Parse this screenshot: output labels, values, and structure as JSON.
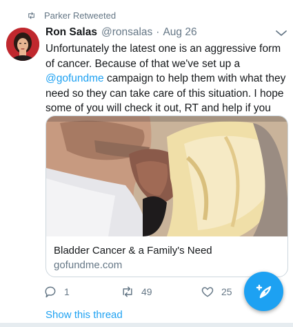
{
  "retweet": {
    "label": "Parker Retweeted"
  },
  "author": {
    "name": "Ron Salas",
    "handle": "@ronsalas",
    "separator": "·",
    "date": "Aug 26"
  },
  "tweet": {
    "text_before": "Unfortunately the latest one is an aggressive form of cancer. Because of that we've set up a ",
    "mention": "@gofundme",
    "text_after": " campaign to help them with what they need so they can take care of this situation. I hope some of you will check it out, RT and help if you can."
  },
  "card": {
    "title": "Bladder Cancer & a Family's Need",
    "domain": "gofundme.com"
  },
  "actions": {
    "replies": "1",
    "retweets": "49",
    "likes": "25"
  },
  "thread_link": "Show this thread",
  "colors": {
    "accent": "#1da1f2",
    "secondary_text": "#657786",
    "border": "#ccd6dd"
  },
  "icons": [
    "retweet-icon",
    "chevron-down-icon",
    "reply-icon",
    "like-icon",
    "compose-icon"
  ]
}
